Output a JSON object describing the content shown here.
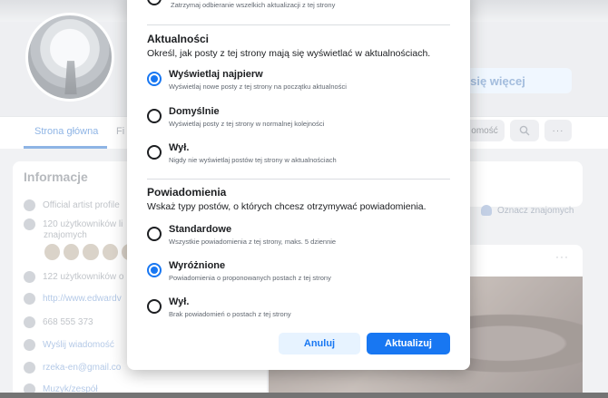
{
  "background": {
    "learn_more_button": "z się więcej",
    "nav_home": "Strona główna",
    "nav_partial": "Fi",
    "nav_partial_button": "omość",
    "info_title": "Informacje",
    "info_rows": [
      {
        "text": "Official artist profile"
      },
      {
        "text": "120 użytkowników li"
      },
      {
        "text": "znajomych"
      },
      {
        "text": "122 użytkowników o"
      },
      {
        "text": "http://www.edwardv"
      },
      {
        "text": "668 555 373"
      },
      {
        "text": "Wyślij wiadomość"
      },
      {
        "text": "rzeka-en@gmail.co"
      },
      {
        "text": "Muzyk/zespół"
      }
    ],
    "tag_friends": "Oznacz znajomych",
    "post_more": "···",
    "partial_letter": "z"
  },
  "modal": {
    "top_option_desc": "Zatrzymaj odbieranie wszelkich aktualizacji z tej strony",
    "news_section": {
      "title": "Aktualności",
      "description": "Określ, jak posty z tej strony mają się wyświetlać w aktualnościach.",
      "options": [
        {
          "title": "Wyświetlaj najpierw",
          "desc": "Wyświetlaj nowe posty z tej strony na początku aktualności",
          "checked": true
        },
        {
          "title": "Domyślnie",
          "desc": "Wyświetlaj posty z tej strony w normalnej kolejności",
          "checked": false
        },
        {
          "title": "Wył.",
          "desc": "Nigdy nie wyświetlaj postów tej strony w aktualnościach",
          "checked": false
        }
      ]
    },
    "notif_section": {
      "title": "Powiadomienia",
      "description": "Wskaż typy postów, o których chcesz otrzymywać powiadomienia.",
      "options": [
        {
          "title": "Standardowe",
          "desc": "Wszystkie powiadomienia z tej strony, maks. 5 dziennie",
          "checked": false
        },
        {
          "title": "Wyróżnione",
          "desc": "Powiadomienia o proponowanych postach z tej strony",
          "checked": true
        },
        {
          "title": "Wył.",
          "desc": "Brak powiadomień o postach z tej strony",
          "checked": false
        }
      ]
    },
    "cancel_label": "Anuluj",
    "update_label": "Aktualizuj"
  }
}
